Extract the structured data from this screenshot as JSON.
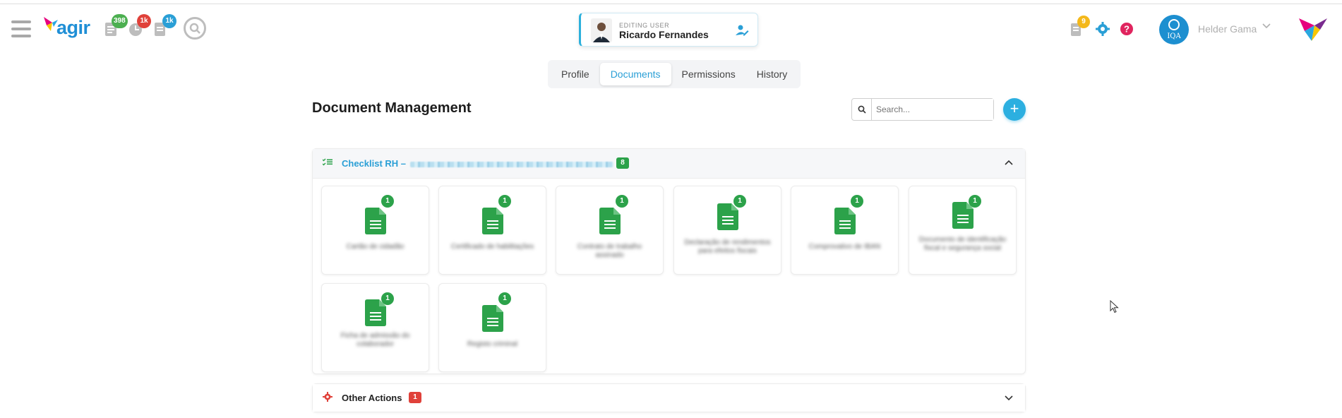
{
  "app": {
    "logo_text": "agir",
    "header_badges": [
      "398",
      "1k",
      "1k"
    ],
    "notification_badge": "9"
  },
  "editing_user": {
    "label": "EDITING USER",
    "name": "Ricardo Fernandes"
  },
  "user_menu": {
    "avatar_text": "IQA",
    "name": "Helder Gama"
  },
  "tabs": [
    {
      "label": "Profile",
      "active": false
    },
    {
      "label": "Documents",
      "active": true
    },
    {
      "label": "Permissions",
      "active": false
    },
    {
      "label": "History",
      "active": false
    }
  ],
  "main": {
    "title": "Document Management",
    "search_placeholder": "Search..."
  },
  "sections": [
    {
      "title": "Checklist RH –",
      "count": "8",
      "expanded": true,
      "documents": [
        {
          "name": "Cartão de cidadão",
          "count": "1"
        },
        {
          "name": "Certificado de habilitações",
          "count": "1"
        },
        {
          "name": "Contrato de trabalho assinado",
          "count": "1"
        },
        {
          "name": "Declaração de rendimentos para efeitos fiscais",
          "count": "1"
        },
        {
          "name": "Comprovativo de IBAN",
          "count": "1"
        },
        {
          "name": "Documento de identificação fiscal e segurança social",
          "count": "1"
        },
        {
          "name": "Ficha de admissão do colaborador",
          "count": "1"
        },
        {
          "name": "Registo criminal",
          "count": "1"
        }
      ]
    },
    {
      "title": "Other Actions",
      "count": "1",
      "expanded": false
    }
  ],
  "colors": {
    "accent": "#2a9fd6",
    "doc_green": "#2ca24a",
    "badge_red": "#e0413a"
  }
}
